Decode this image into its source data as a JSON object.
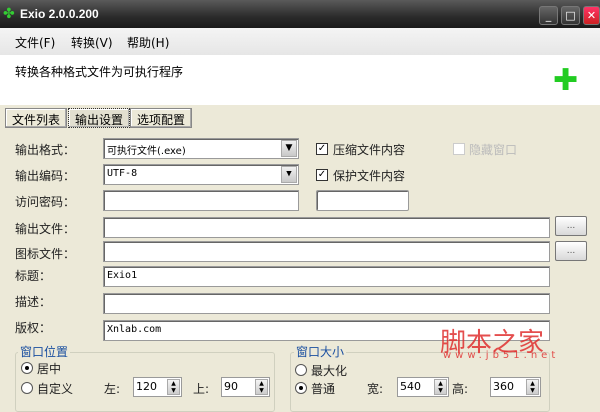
{
  "window": {
    "title": "Exio 2.0.0.200",
    "minimize": "_",
    "maximize": "□",
    "close": "✕"
  },
  "menu": [
    "文件(F)",
    "转换(V)",
    "帮助(H)"
  ],
  "header": {
    "description": "转换各种格式文件为可执行程序"
  },
  "tabs": [
    "文件列表",
    "输出设置",
    "选项配置"
  ],
  "form": {
    "output_format": {
      "label": "输出格式：",
      "value": "可执行文件(.exe)"
    },
    "output_encoding": {
      "label": "输出编码：",
      "value": "UTF-8"
    },
    "access_password": {
      "label": "访问密码：",
      "value": "",
      "value2": ""
    },
    "output_file": {
      "label": "输出文件：",
      "value": "",
      "browse": "..."
    },
    "icon_file": {
      "label": "图标文件：",
      "value": "",
      "browse": "..."
    },
    "title": {
      "label": "标题：",
      "value": "Exio1"
    },
    "description": {
      "label": "描述：",
      "value": ""
    },
    "copyright": {
      "label": "版权：",
      "value": "Xnlab.com"
    },
    "compress": {
      "label": "压缩文件内容",
      "checked": true
    },
    "protect": {
      "label": "保护文件内容",
      "checked": true
    },
    "hide_window": {
      "label": "隐藏窗口",
      "checked": false,
      "disabled": true
    }
  },
  "window_position": {
    "title": "窗口位置",
    "center": "居中",
    "custom": "自定义",
    "left_label": "左:",
    "left": "120",
    "top_label": "上:",
    "top": "90",
    "selected": "center"
  },
  "window_size": {
    "title": "窗口大小",
    "maximize": "最大化",
    "normal": "普通",
    "width_label": "宽:",
    "width": "540",
    "height_label": "高:",
    "height": "360",
    "selected": "normal"
  },
  "watermark": {
    "name": "脚本之家",
    "url": "www.jb51.net"
  }
}
